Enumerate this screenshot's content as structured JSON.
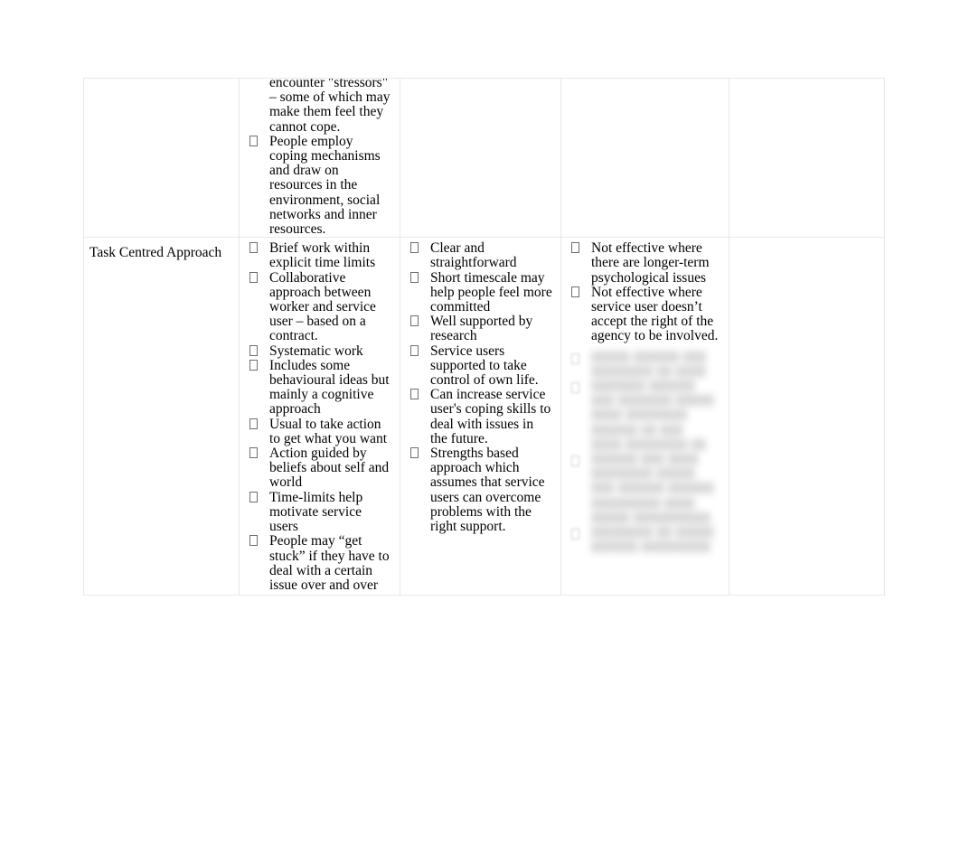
{
  "document": {
    "type": "table",
    "columns": 5,
    "rows": 2,
    "note_top_row": "continuation of a cell from the previous page (text clipped at top of page)"
  },
  "table": {
    "row_previous": {
      "col1_approach": "",
      "col2_description": {
        "continuation_text": "encounter \"stressors\" – some of which may make them feel they cannot cope.",
        "bullets": [
          "People employ coping mechanisms and draw on resources in the environment, social networks and inner resources."
        ]
      },
      "col3_strengths": "",
      "col4_limitations": "",
      "col5_other": ""
    },
    "row_task_centred": {
      "col1_approach": "Task Centred Approach",
      "col2_description_bullets": [
        "Brief work within explicit time limits",
        "Collaborative approach between worker and service user – based on a contract.",
        "Systematic work",
        "Includes some behavioural ideas but mainly a cognitive approach",
        "Usual to take action to get what you want",
        "Action guided by beliefs about self and world",
        "Time-limits help motivate service users",
        "People may “get stuck” if they have to deal with a certain issue over and over"
      ],
      "col3_strengths_bullets": [
        "Clear and straightforward",
        "Short timescale may help people feel more committed",
        "Well supported by research",
        "Service users supported to take control of own life.",
        "Can increase service user's coping skills to deal with issues in the future.",
        "Strengths based approach which assumes that service users can overcome problems with the right support."
      ],
      "col4_limitations_bullets": [
        "Not effective where there are longer-term psychological issues",
        "Not effective where service user doesn’t accept the right of the agency to be involved."
      ],
      "col4_redacted": {
        "is_blurred": true,
        "legible": false,
        "bullet_count": 4,
        "placeholder_lines": [
          "▮▮▮▮▮ ▮▮▮▮▮▮ ▮▮▮",
          "▮▮▮▮▮▮▮▮ ▮▮ ▮▮▮▮",
          "▮▮▮▮▮▮▮ ▮▮▮▮▮▮",
          "▮▮▮ ▮▮▮▮▮▮▮ ▮▮▮▮▮",
          "▮▮▮▮ ▮▮▮▮▮▮▮▮",
          "▮▮▮▮▮▮ ▮▮ ▮▮▮",
          "▮▮▮▮ ▮▮▮▮▮▮▮▮ ▮▮",
          "▮▮▮▮▮▮ ▮▮▮ ▮▮▮▮",
          "▮▮▮▮▮▮▮▮ ▮▮▮▮▮",
          "▮▮▮ ▮▮▮▮▮▮ ▮▮▮▮▮▮",
          "▮▮▮▮▮▮▮▮▮ ▮▮▮▮",
          "▮▮▮▮▮ ▮▮▮▮▮▮▮▮▮▮",
          "▮▮▮▮▮▮▮▮ ▮▮ ▮▮▮▮▮",
          "▮▮▮▮▮▮ ▮▮▮▮▮▮▮▮▮"
        ]
      },
      "col5_other": ""
    }
  }
}
